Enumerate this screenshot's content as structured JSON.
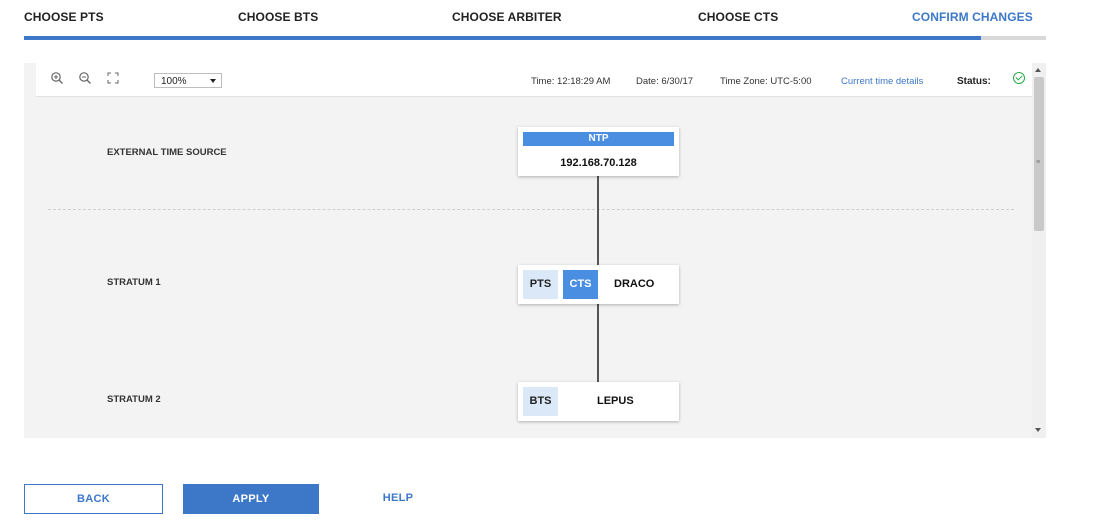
{
  "steps": [
    {
      "label": "CHOOSE PTS"
    },
    {
      "label": "CHOOSE BTS"
    },
    {
      "label": "CHOOSE ARBITER"
    },
    {
      "label": "CHOOSE CTS"
    },
    {
      "label": "CONFIRM CHANGES"
    }
  ],
  "active_step": 4,
  "progress_fraction": 0.936,
  "colors": {
    "accent": "#3d78c8",
    "tag_dark": "#4a8ee2",
    "tag_light": "#dbe8f8",
    "status_ok": "#2aa84a",
    "panel_bg": "#f2f3f2"
  },
  "toolbar": {
    "icons": [
      "zoom-in-icon",
      "zoom-out-icon",
      "fit-to-screen-icon"
    ],
    "zoom_value": "100%",
    "time": "Time: 12:18:29 AM",
    "date": "Date: 6/30/17",
    "timezone": "Time Zone: UTC-5:00",
    "details_link": "Current time details",
    "status_label": "Status:",
    "status_icon": "check-circle-icon"
  },
  "diagram": {
    "rows": [
      {
        "label": "EXTERNAL TIME SOURCE"
      },
      {
        "label": "STRATUM 1"
      },
      {
        "label": "STRATUM 2"
      }
    ],
    "ntp": {
      "header": "NTP",
      "address": "192.168.70.128"
    },
    "servers": [
      {
        "name": "DRACO",
        "tags": [
          "PTS",
          "CTS"
        ]
      },
      {
        "name": "LEPUS",
        "tags": [
          "BTS"
        ]
      }
    ]
  },
  "buttons": {
    "back": "BACK",
    "apply": "APPLY",
    "help": "HELP"
  }
}
